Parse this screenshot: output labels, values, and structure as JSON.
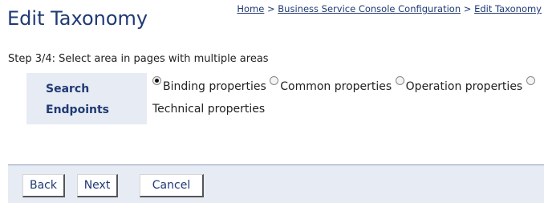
{
  "page": {
    "title": "Edit Taxonomy",
    "breadcrumb": {
      "home": "Home",
      "separator": ">",
      "config": "Business Service Console Configuration",
      "current": "Edit Taxonomy"
    },
    "step_text": "Step 3/4: Select area in pages with multiple areas"
  },
  "form": {
    "label_line1": "Search",
    "label_line2": "Endpoints",
    "options": [
      {
        "label": "Binding properties",
        "checked": true
      },
      {
        "label": "Common properties",
        "checked": false
      },
      {
        "label": "Operation properties",
        "checked": false
      },
      {
        "label": "Technical properties",
        "checked": false
      }
    ]
  },
  "buttons": {
    "back": "Back",
    "next": "Next",
    "cancel": "Cancel"
  },
  "colors": {
    "title": "#1f3a74",
    "panel_bg": "#e6ebf4"
  }
}
